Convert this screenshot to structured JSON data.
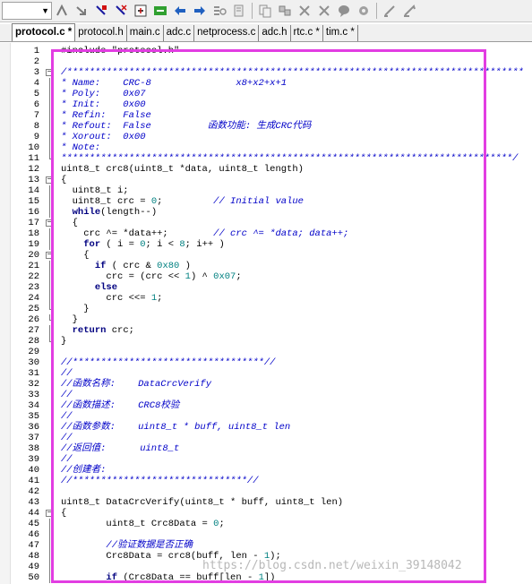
{
  "toolbar": {
    "icons": [
      "bookmark-toggle-icon",
      "bookmark-prev-icon",
      "bookmark-next-icon",
      "bookmark-clear-icon",
      "indent-icon",
      "unindent-icon",
      "comment-icon",
      "uncomment-icon",
      "find-in-files-icon",
      "find-icon",
      "incremental-find-icon",
      "debug-icon",
      "breakpoint-icon",
      "disable-breakpoint-icon"
    ]
  },
  "tabs": [
    {
      "label": "protocol.c *",
      "active": true
    },
    {
      "label": "protocol.h",
      "active": false
    },
    {
      "label": "main.c",
      "active": false
    },
    {
      "label": "adc.c",
      "active": false
    },
    {
      "label": "netprocess.c",
      "active": false
    },
    {
      "label": "adc.h",
      "active": false
    },
    {
      "label": "rtc.c *",
      "active": false
    },
    {
      "label": "tim.c *",
      "active": false
    }
  ],
  "code_lines": [
    {
      "n": "1",
      "text": "#include \"protocol.h\"",
      "fold": ""
    },
    {
      "n": "2",
      "text": "",
      "fold": ""
    },
    {
      "n": "3",
      "text": "/*********************************************************************************",
      "fold": "minus",
      "type": "comment"
    },
    {
      "n": "4",
      "text": "* Name:    CRC-8               x8+x2+x+1",
      "fold": "line",
      "type": "comment"
    },
    {
      "n": "5",
      "text": "* Poly:    0x07",
      "fold": "line",
      "type": "comment"
    },
    {
      "n": "6",
      "text": "* Init:    0x00",
      "fold": "line",
      "type": "comment"
    },
    {
      "n": "7",
      "text": "* Refin:   False",
      "fold": "line",
      "type": "comment"
    },
    {
      "n": "8",
      "text": "* Refout:  False          函数功能: 生成CRC代码",
      "fold": "line",
      "type": "comment"
    },
    {
      "n": "9",
      "text": "* Xorout:  0x00",
      "fold": "line",
      "type": "comment"
    },
    {
      "n": "10",
      "text": "* Note:",
      "fold": "line",
      "type": "comment"
    },
    {
      "n": "11",
      "text": "********************************************************************************/",
      "fold": "end",
      "type": "comment"
    },
    {
      "n": "12",
      "text": "uint8_t crc8(uint8_t *data, uint8_t length)",
      "fold": ""
    },
    {
      "n": "13",
      "text": "{",
      "fold": "minus"
    },
    {
      "n": "14",
      "text": "  uint8_t i;",
      "fold": "line"
    },
    {
      "n": "15",
      "text": "  uint8_t crc = 0;         // Initial value",
      "fold": "line"
    },
    {
      "n": "16",
      "text": "  while(length--)",
      "fold": "line"
    },
    {
      "n": "17",
      "text": "  {",
      "fold": "minus"
    },
    {
      "n": "18",
      "text": "    crc ^= *data++;        // crc ^= *data; data++;",
      "fold": "line"
    },
    {
      "n": "19",
      "text": "    for ( i = 0; i < 8; i++ )",
      "fold": "line"
    },
    {
      "n": "20",
      "text": "    {",
      "fold": "minus"
    },
    {
      "n": "21",
      "text": "      if ( crc & 0x80 )",
      "fold": "line"
    },
    {
      "n": "22",
      "text": "        crc = (crc << 1) ^ 0x07;",
      "fold": "line"
    },
    {
      "n": "23",
      "text": "      else",
      "fold": "line"
    },
    {
      "n": "24",
      "text": "        crc <<= 1;",
      "fold": "line"
    },
    {
      "n": "25",
      "text": "    }",
      "fold": "end"
    },
    {
      "n": "26",
      "text": "  }",
      "fold": "end"
    },
    {
      "n": "27",
      "text": "  return crc;",
      "fold": "line"
    },
    {
      "n": "28",
      "text": "}",
      "fold": "end"
    },
    {
      "n": "29",
      "text": "",
      "fold": ""
    },
    {
      "n": "30",
      "text": "//**********************************//",
      "fold": "",
      "type": "comment"
    },
    {
      "n": "31",
      "text": "//",
      "fold": "",
      "type": "comment"
    },
    {
      "n": "32",
      "text": "//函数名称:    DataCrcVerify",
      "fold": "",
      "type": "comment"
    },
    {
      "n": "33",
      "text": "//",
      "fold": "",
      "type": "comment"
    },
    {
      "n": "34",
      "text": "//函数描述:    CRC8校验",
      "fold": "",
      "type": "comment"
    },
    {
      "n": "35",
      "text": "//",
      "fold": "",
      "type": "comment"
    },
    {
      "n": "36",
      "text": "//函数参数:    uint8_t * buff, uint8_t len",
      "fold": "",
      "type": "comment"
    },
    {
      "n": "37",
      "text": "//",
      "fold": "",
      "type": "comment"
    },
    {
      "n": "38",
      "text": "//返回值:      uint8_t",
      "fold": "",
      "type": "comment"
    },
    {
      "n": "39",
      "text": "//",
      "fold": "",
      "type": "comment"
    },
    {
      "n": "40",
      "text": "//创建者:",
      "fold": "",
      "type": "comment"
    },
    {
      "n": "41",
      "text": "//*******************************//",
      "fold": "",
      "type": "comment"
    },
    {
      "n": "42",
      "text": "",
      "fold": ""
    },
    {
      "n": "43",
      "text": "uint8_t DataCrcVerify(uint8_t * buff, uint8_t len)",
      "fold": ""
    },
    {
      "n": "44",
      "text": "{",
      "fold": "minus"
    },
    {
      "n": "45",
      "text": "        uint8_t Crc8Data = 0;",
      "fold": "line"
    },
    {
      "n": "46",
      "text": "",
      "fold": "line"
    },
    {
      "n": "47",
      "text": "        //验证数据是否正确",
      "fold": "line",
      "type": "comment"
    },
    {
      "n": "48",
      "text": "        Crc8Data = crc8(buff, len - 1);",
      "fold": "line"
    },
    {
      "n": "49",
      "text": "",
      "fold": "line"
    },
    {
      "n": "50",
      "text": "        if (Crc8Data == buff[len - 1])",
      "fold": "line"
    }
  ],
  "watermark": "https://blog.csdn.net/weixin_39148042"
}
